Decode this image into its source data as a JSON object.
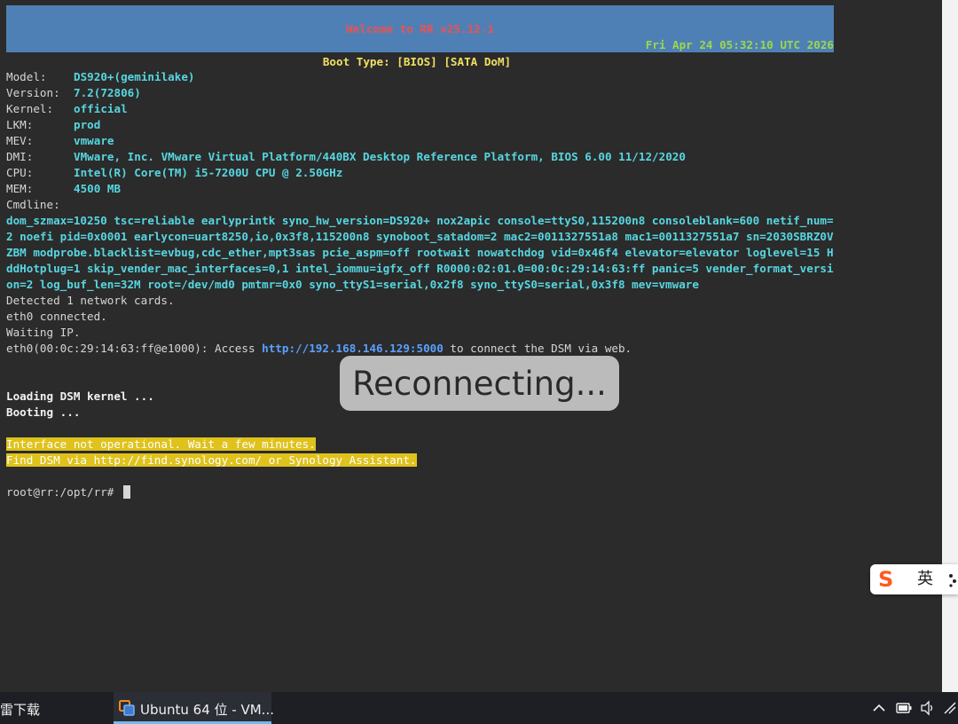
{
  "console": {
    "banner_title": "Welcome to RR v25.12.1",
    "banner_datetime": "Fri Apr 24 05:32:10 UTC 2026",
    "boot_type": "Boot Type: [BIOS] [SATA DoM]",
    "info": [
      {
        "label": "Model:",
        "value": "DS920+(geminilake)"
      },
      {
        "label": "Version:",
        "value": "7.2(72806)"
      },
      {
        "label": "Kernel:",
        "value": "official"
      },
      {
        "label": "LKM:",
        "value": "prod"
      },
      {
        "label": "MEV:",
        "value": "vmware"
      },
      {
        "label": "DMI:",
        "value": "VMware, Inc. VMware Virtual Platform/440BX Desktop Reference Platform, BIOS 6.00 11/12/2020"
      },
      {
        "label": "CPU:",
        "value": "Intel(R) Core(TM) i5-7200U CPU @ 2.50GHz"
      },
      {
        "label": "MEM:",
        "value": "4500 MB"
      }
    ],
    "cmdline_label": "Cmdline:",
    "cmdline_lines": [
      "dom_szmax=10250 tsc=reliable earlyprintk syno_hw_version=DS920+ nox2apic console=ttyS0,115200n8 consoleblank=600 netif_num=",
      "2 noefi pid=0x0001 earlycon=uart8250,io,0x3f8,115200n8 synoboot_satadom=2 mac2=0011327551a8 mac1=0011327551a7 sn=2030SBRZ0V",
      "ZBM modprobe.blacklist=evbug,cdc_ether,mpt3sas pcie_aspm=off rootwait nowatchdog vid=0x46f4 elevator=elevator loglevel=15 H",
      "ddHotplug=1 skip_vender_mac_interfaces=0,1 intel_iommu=igfx_off R0000:02:01.0=00:0c:29:14:63:ff panic=5 vender_format_versi",
      "on=2 log_buf_len=32M root=/dev/md0 pmtmr=0x0 syno_ttyS1=serial,0x2f8 syno_ttyS0=serial,0x3f8 mev=vmware"
    ],
    "net_lines": [
      "Detected 1 network cards.",
      "eth0 connected.",
      "Waiting IP."
    ],
    "access_prefix": "eth0(00:0c:29:14:63:ff@e1000): Access ",
    "access_url": "http://192.168.146.129:5000",
    "access_suffix": " to connect the DSM via web.",
    "loading": "Loading DSM kernel ...",
    "booting": "Booting ...",
    "warn_1": "Interface not operational. Wait a few minutes.",
    "warn_2": "Find DSM via http://find.synology.com/ or Synology Assistant.",
    "prompt": "root@rr:/opt/rr# "
  },
  "overlay": {
    "reconnecting": "Reconnecting..."
  },
  "ime": {
    "logo": "S",
    "mode": "英"
  },
  "taskbar": {
    "left_item": "雷下载",
    "active_item": "Ubuntu 64 位 - VM..."
  },
  "colors": {
    "banner": "#4f80b5",
    "title_red": "#f05050",
    "date_green": "#9ad84a",
    "value_cyan": "#57d6e0",
    "highlight": "#dfc21c",
    "link": "#5aa0ff"
  }
}
